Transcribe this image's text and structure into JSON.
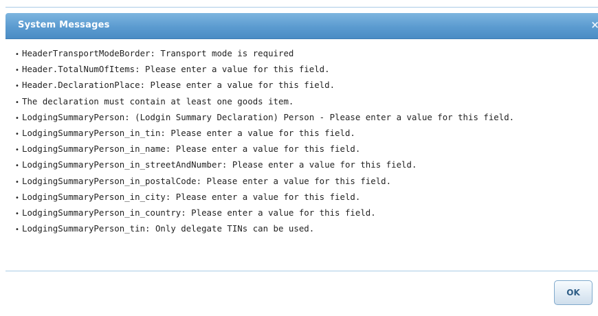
{
  "dialog": {
    "title": "System Messages",
    "close_icon": "×",
    "messages": [
      "HeaderTransportModeBorder: Transport mode is required",
      "Header.TotalNumOfItems: Please enter a value for this field.",
      "Header.DeclarationPlace: Please enter a value for this field.",
      "The declaration must contain at least one goods item.",
      "LodgingSummaryPerson: (Lodgin Summary Declaration) Person - Please enter a value for this field.",
      "LodgingSummaryPerson_in_tin: Please enter a value for this field.",
      "LodgingSummaryPerson_in_name: Please enter a value for this field.",
      "LodgingSummaryPerson_in_streetAndNumber: Please enter a value for this field.",
      "LodgingSummaryPerson_in_postalCode: Please enter a value for this field.",
      "LodgingSummaryPerson_in_city: Please enter a value for this field.",
      "LodgingSummaryPerson_in_country: Please enter a value for this field.",
      "LodgingSummaryPerson_tin: Only delegate TINs can be used."
    ],
    "ok_label": "OK"
  },
  "colors": {
    "title_bar": "#5b9bd0",
    "title_text": "#ffffff",
    "button_text": "#2e5d86"
  }
}
